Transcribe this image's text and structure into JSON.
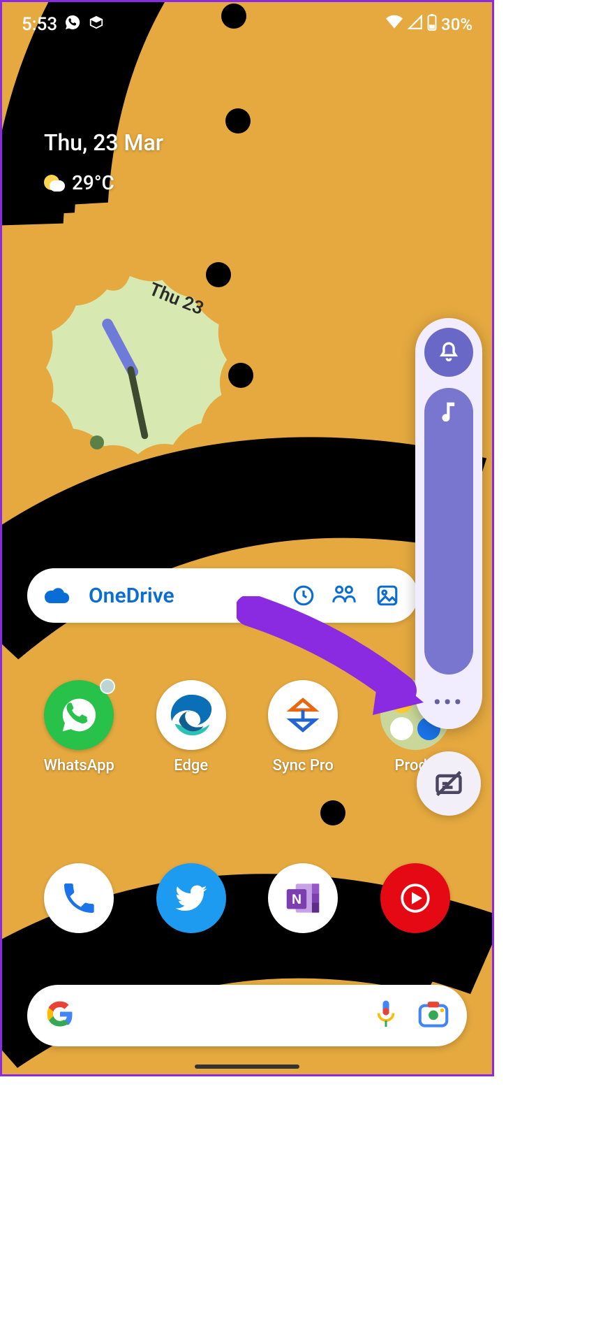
{
  "status": {
    "time": "5:53",
    "battery": "30%",
    "icons_left": [
      "whatsapp-notif",
      "package-notif"
    ],
    "icons_right": [
      "wifi",
      "signal",
      "battery"
    ]
  },
  "date_widget": {
    "date_label": "Thu, 23 Mar",
    "temp": "29°C"
  },
  "clock_widget": {
    "day_label": "Thu 23"
  },
  "onedrive": {
    "title": "OneDrive"
  },
  "apps_row1": [
    {
      "name": "WhatsApp",
      "label": "WhatsApp",
      "bg": "#28c14a",
      "has_notif": true
    },
    {
      "name": "Edge",
      "label": "Edge",
      "bg": "#ffffff"
    },
    {
      "name": "SyncPro",
      "label": "Sync Pro",
      "bg": "#ffffff"
    },
    {
      "name": "Productivity",
      "label": "Produ",
      "bg": "folder"
    }
  ],
  "apps_row2": [
    {
      "name": "Phone",
      "label": "",
      "bg": "#ffffff"
    },
    {
      "name": "Twitter",
      "label": "",
      "bg": "#1d9bf0"
    },
    {
      "name": "OneNote",
      "label": "",
      "bg": "#ffffff"
    },
    {
      "name": "YTMusic",
      "label": "",
      "bg": "#e50914"
    }
  ],
  "volume_panel": {
    "ring_mode": "ring",
    "more_label": "•••"
  },
  "colors": {
    "accent": "#6a68c7",
    "arrow": "#8a2be2",
    "onedrive": "#0a6dd6"
  }
}
